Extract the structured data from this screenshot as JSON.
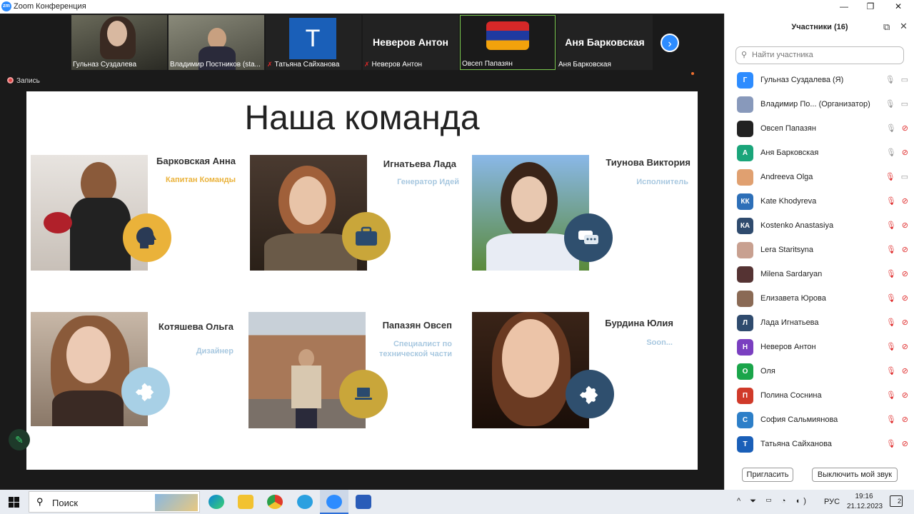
{
  "window": {
    "title": "Zoom Конференция",
    "minimize": "—",
    "maximize": "❐",
    "close": "✕"
  },
  "thumbnails": [
    {
      "name": "Гульназ Суздалева",
      "type": "video"
    },
    {
      "name": "Владимир Постников (sta...",
      "type": "video"
    },
    {
      "name": "Татьяна Сайханова",
      "type": "avatar",
      "letter": "T",
      "muted": true
    },
    {
      "name": "Неверов Антон",
      "type": "text",
      "muted": true
    },
    {
      "name": "Овсеп Папазян",
      "type": "video"
    },
    {
      "name": "Аня Барковская",
      "type": "text"
    }
  ],
  "recording_label": "Запись",
  "slide": {
    "title": "Наша команда",
    "members": [
      {
        "name": "Барковская Анна",
        "role": "Капитан Команды",
        "icon": "brain-icon"
      },
      {
        "name": "Игнатьева Лада",
        "role": "Генератор Идей",
        "icon": "briefcase-icon"
      },
      {
        "name": "Тиунова Виктория",
        "role": "Исполнитель",
        "icon": "chat-icon"
      },
      {
        "name": "Котяшева Ольга",
        "role": "Дизайнер",
        "icon": "puzzle-icon"
      },
      {
        "name": "Папазян Овсеп",
        "role": "Специалист по технической части",
        "icon": "laptop-icon"
      },
      {
        "name": "Бурдина Юлия",
        "role": "Soon...",
        "icon": "puzzle-icon"
      }
    ]
  },
  "participants": {
    "title": "Участники (16)",
    "search_placeholder": "Найти участника",
    "list": [
      {
        "name": "Гульназ Суздалева (Я)",
        "initials": "Г",
        "color": "#2d8cff",
        "mic": "on",
        "cam": "on"
      },
      {
        "name": "Владимир По... (Организатор)",
        "initials": "",
        "color": "#8899bb",
        "mic": "on",
        "cam": "on"
      },
      {
        "name": "Овсеп Папазян",
        "initials": "",
        "color": "#222222",
        "mic": "on",
        "cam": "off"
      },
      {
        "name": "Аня Барковская",
        "initials": "А",
        "color": "#1aa57a",
        "mic": "on",
        "cam": "off"
      },
      {
        "name": "Andreeva Olga",
        "initials": "",
        "color": "#e0a070",
        "mic": "off",
        "cam": "on"
      },
      {
        "name": "Kate Khodyreva",
        "initials": "КК",
        "color": "#2d6fb8",
        "mic": "off",
        "cam": "off"
      },
      {
        "name": "Kostenko Anastasiya",
        "initials": "КА",
        "color": "#2f4b6e",
        "mic": "off",
        "cam": "off"
      },
      {
        "name": "Lera Staritsyna",
        "initials": "",
        "color": "#c8a090",
        "mic": "off",
        "cam": "off"
      },
      {
        "name": "Milena Sardaryan",
        "initials": "",
        "color": "#553333",
        "mic": "off",
        "cam": "off"
      },
      {
        "name": "Елизавета Юрова",
        "initials": "",
        "color": "#8a6a55",
        "mic": "off",
        "cam": "off"
      },
      {
        "name": "Лада Игнатьева",
        "initials": "Л",
        "color": "#2f4b6e",
        "mic": "off",
        "cam": "off"
      },
      {
        "name": "Неверов Антон",
        "initials": "Н",
        "color": "#7a3fc0",
        "mic": "off",
        "cam": "off"
      },
      {
        "name": "Оля",
        "initials": "О",
        "color": "#1aa54a",
        "mic": "off",
        "cam": "off"
      },
      {
        "name": "Полина Соснина",
        "initials": "П",
        "color": "#d03a2a",
        "mic": "off",
        "cam": "off"
      },
      {
        "name": "София Сальмиянова",
        "initials": "С",
        "color": "#2d7fc8",
        "mic": "off",
        "cam": "off"
      },
      {
        "name": "Татьяна Сайханова",
        "initials": "Т",
        "color": "#1a5fb8",
        "mic": "off",
        "cam": "off"
      }
    ],
    "invite": "Пригласить",
    "mute_me": "Выключить мой звук"
  },
  "taskbar": {
    "search": "Поиск",
    "lang": "РУС",
    "time": "19:16",
    "date": "21.12.2023",
    "notif": "2"
  }
}
